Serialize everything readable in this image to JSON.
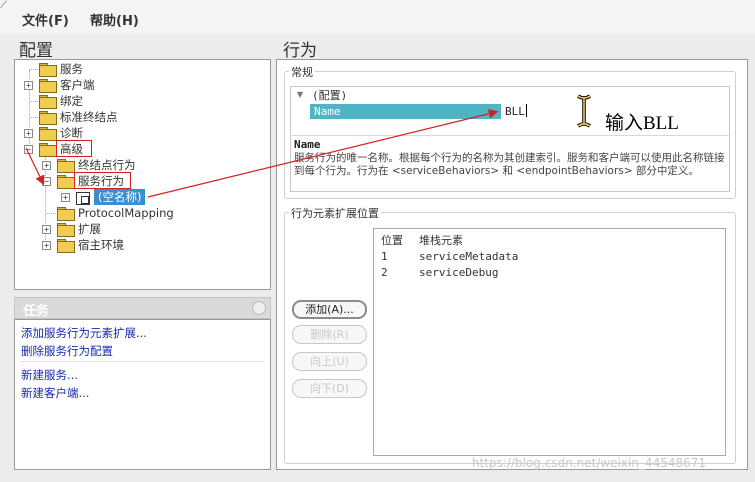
{
  "menubar": {
    "file": "文件(F)",
    "help": "帮助(H)"
  },
  "config": {
    "title": "配置"
  },
  "tree": {
    "items": [
      {
        "label": "服务"
      },
      {
        "label": "客户端"
      },
      {
        "label": "绑定"
      },
      {
        "label": "标准终结点"
      },
      {
        "label": "诊断"
      },
      {
        "label": "高级"
      },
      {
        "label": "终结点行为"
      },
      {
        "label": "服务行为"
      },
      {
        "label": "(空名称)"
      },
      {
        "label": "ProtocolMapping"
      },
      {
        "label": "扩展"
      },
      {
        "label": "宿主环境"
      }
    ]
  },
  "tasks": {
    "title": "任务",
    "links": [
      "添加服务行为元素扩展...",
      "删除服务行为配置",
      "新建服务...",
      "新建客户端..."
    ]
  },
  "behavior": {
    "title": "行为",
    "general_group": "常规",
    "category": "(配置)",
    "property_name": "Name",
    "property_value": "BLL",
    "desc_title": "Name",
    "desc_text": "服务行为的唯一名称。根据每个行为的名称为其创建索引。服务和客户端可以使用此名称链接到每个行为。行为在 <serviceBehaviors> 和 <endpointBehaviors> 部分中定义。",
    "annotation": "输入BLL",
    "ext_group": "行为元素扩展位置",
    "ext_columns": [
      "位置",
      "堆栈元素"
    ],
    "ext_rows": [
      {
        "pos": "1",
        "element": "serviceMetadata"
      },
      {
        "pos": "2",
        "element": "serviceDebug"
      }
    ],
    "buttons": {
      "add": "添加(A)...",
      "remove": "删除(R)",
      "up": "向上(U)",
      "down": "向下(D)"
    }
  },
  "watermark": "https://blog.csdn.net/weixin_44548671",
  "colors": {
    "selection": "#3b8fcf",
    "property_highlight": "#4fb4c4",
    "annotation_red": "#d42020",
    "link": "#1a2aa8"
  }
}
